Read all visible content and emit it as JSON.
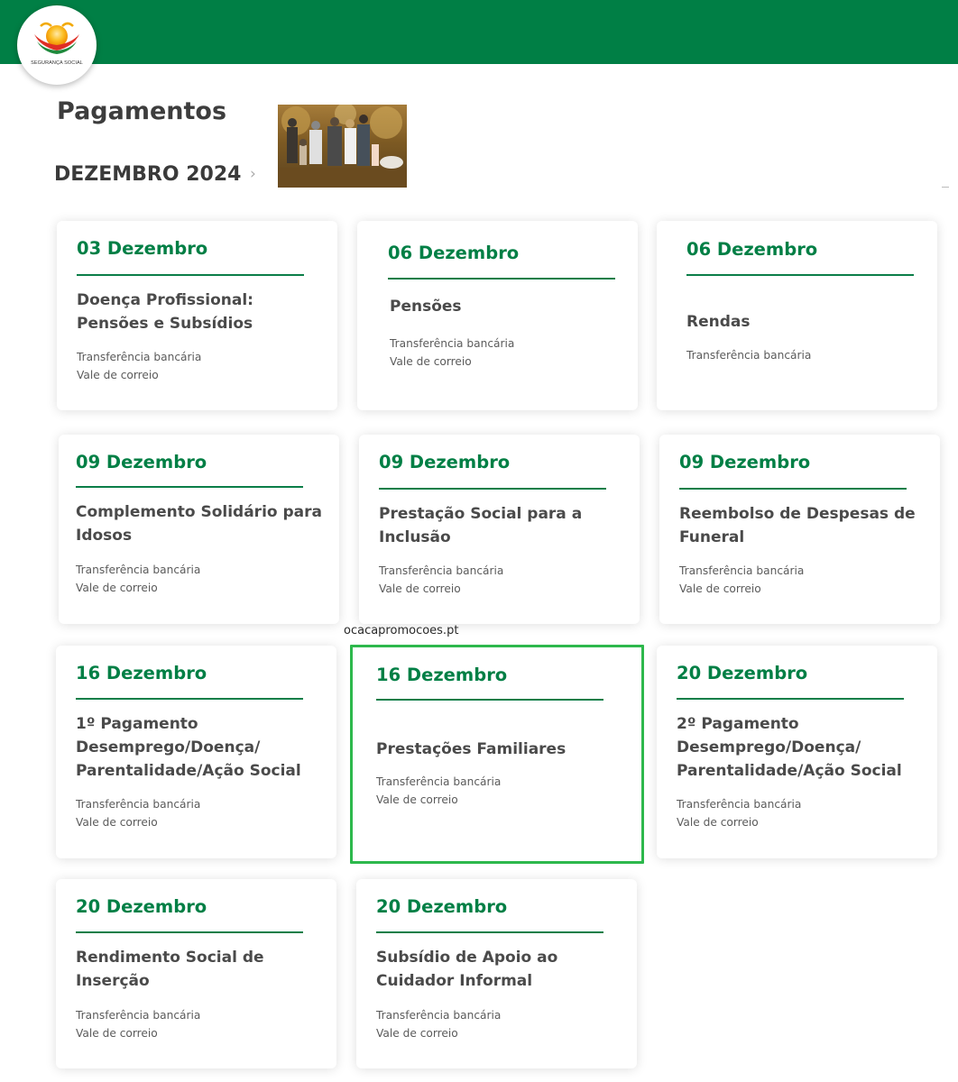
{
  "header": {
    "brand": "SEGURANÇA SOCIAL",
    "brand_colors": {
      "green": "#007f45",
      "orange": "#f59e0b",
      "red": "#dc2626"
    }
  },
  "page": {
    "title": "Pagamentos",
    "month": "DEZEMBRO 2024",
    "month_chevron_icon": "chevron-right-icon",
    "photo": "family-walking-in-park-photo"
  },
  "watermark": "ocacapromocoes.pt",
  "cards": [
    {
      "date": "03 Dezembro",
      "title": "Doença Profissional: Pensões e Subsídios",
      "methods": [
        "Transferência bancária",
        "Vale de correio"
      ]
    },
    {
      "date": "06 Dezembro",
      "title": "Pensões",
      "methods": [
        "Transferência bancária",
        "Vale de correio"
      ]
    },
    {
      "date": "06 Dezembro",
      "title": "Rendas",
      "methods": [
        "Transferência bancária"
      ]
    },
    {
      "date": "09 Dezembro",
      "title": "Complemento Solidário para Idosos",
      "methods": [
        "Transferência bancária",
        "Vale de correio"
      ]
    },
    {
      "date": "09 Dezembro",
      "title": "Prestação Social para a Inclusão",
      "methods": [
        "Transferência bancária",
        "Vale de correio"
      ]
    },
    {
      "date": "09 Dezembro",
      "title": "Reembolso de Despesas de Funeral",
      "methods": [
        "Transferência bancária",
        "Vale de correio"
      ]
    },
    {
      "date": "16 Dezembro",
      "title": "1º Pagamento Desemprego/Doença/ Parentalidade/Ação Social",
      "methods": [
        "Transferência bancária",
        "Vale de correio"
      ]
    },
    {
      "date": "16 Dezembro",
      "title": "Prestações Familiares",
      "methods": [
        "Transferência bancária",
        "Vale de correio"
      ],
      "highlighted": true
    },
    {
      "date": "20 Dezembro",
      "title": "2º Pagamento Desemprego/Doença/ Parentalidade/Ação Social",
      "methods": [
        "Transferência bancária",
        "Vale de correio"
      ]
    },
    {
      "date": "20 Dezembro",
      "title": "Rendimento Social de Inserção",
      "methods": [
        "Transferência bancária",
        "Vale de correio"
      ]
    },
    {
      "date": "20 Dezembro",
      "title": "Subsídio de Apoio ao Cuidador Informal",
      "methods": [
        "Transferência bancária",
        "Vale de correio"
      ]
    }
  ]
}
